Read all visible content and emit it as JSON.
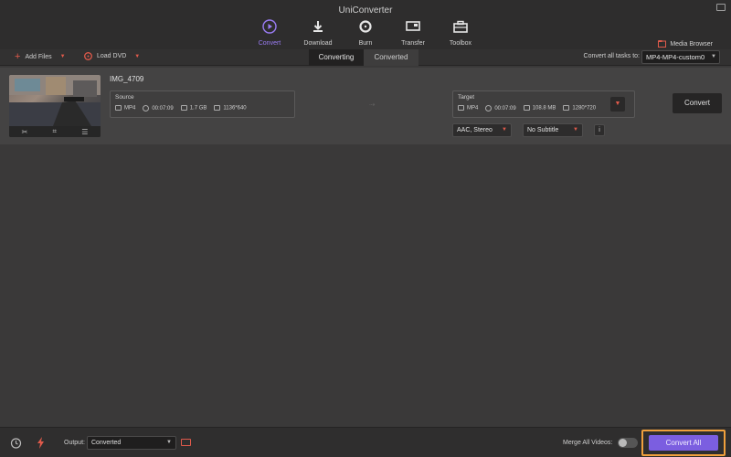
{
  "app": {
    "title": "UniConverter"
  },
  "nav": {
    "items": [
      {
        "label": "Convert",
        "icon": "play-circle-icon",
        "active": true
      },
      {
        "label": "Download",
        "icon": "download-icon"
      },
      {
        "label": "Burn",
        "icon": "disc-icon"
      },
      {
        "label": "Transfer",
        "icon": "transfer-icon"
      },
      {
        "label": "Toolbox",
        "icon": "toolbox-icon"
      }
    ],
    "media_browser": "Media Browser"
  },
  "toolbar": {
    "add_files": "Add Files",
    "load_dvd": "Load DVD",
    "tab_converting": "Converting",
    "tab_converted": "Converted",
    "convert_all_to_label": "Convert all tasks to:",
    "convert_all_to_value": "MP4-MP4-custom0"
  },
  "file": {
    "name": "IMG_4709",
    "source": {
      "label": "Source",
      "format": "MP4",
      "duration": "00:07:09",
      "size": "1.7 GB",
      "resolution": "1136*640"
    },
    "target": {
      "label": "Target",
      "format": "MP4",
      "duration": "00:07:09",
      "size": "108.8 MB",
      "resolution": "1280*720"
    },
    "audio": "AAC, Stereo",
    "subtitle": "No Subtitle",
    "info": "i",
    "convert_label": "Convert"
  },
  "bottom": {
    "output_label": "Output:",
    "output_value": "Converted",
    "merge_label": "Merge All Videos:",
    "merge_on": false,
    "convert_all": "Convert All"
  },
  "colors": {
    "accent": "#7b5ee0",
    "highlight": "#f0a03c",
    "red": "#e05a4b"
  }
}
